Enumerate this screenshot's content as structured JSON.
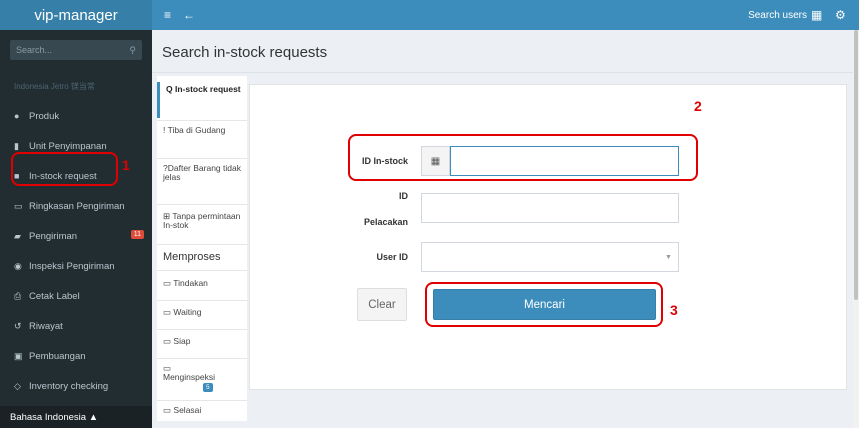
{
  "topbar": {
    "brand": "vip-manager",
    "menu_icon": "≡",
    "back_icon": "←",
    "search_users": "Search users",
    "grid_icon": "▦",
    "settings_icon": "⚙"
  },
  "sidebar": {
    "search_placeholder": "Search...",
    "search_icon": "🔍",
    "header": "Indonesia Jetro 镁当常",
    "items": [
      {
        "label": "Produk",
        "icon": "●"
      },
      {
        "label": "Unit Penyimpanan",
        "icon": "▮"
      },
      {
        "label": "In-stock request",
        "icon": "■"
      },
      {
        "label": "Ringkasan Pengiriman",
        "icon": "▭"
      },
      {
        "label": "Pengiriman",
        "icon": "▰",
        "badge": "11"
      },
      {
        "label": "Inspeksi Pengiriman",
        "icon": "◉"
      },
      {
        "label": "Cetak Label",
        "icon": "⎙"
      },
      {
        "label": "Riwayat",
        "icon": "↺"
      },
      {
        "label": "Pembuangan",
        "icon": "▣"
      },
      {
        "label": "Inventory checking",
        "icon": "◇"
      }
    ],
    "language": "Bahasa Indonesia ▲"
  },
  "page": {
    "title": "Search in-stock requests"
  },
  "subnav": {
    "items": [
      {
        "label": "Q In-stock request"
      },
      {
        "label": "! Tiba di Gudang"
      },
      {
        "label": "?Dafter Barang tidak jelas"
      },
      {
        "label": "Tanpa permintaan In-stok",
        "icon": "⊞"
      }
    ],
    "section": "Memproses",
    "process_items": [
      {
        "label": "Tindakan",
        "icon": "▭"
      },
      {
        "label": "Waiting",
        "icon": "▭"
      },
      {
        "label": "Siap",
        "icon": "▭"
      },
      {
        "label": "Menginspeksi",
        "icon": "▭",
        "badge": "5"
      },
      {
        "label": "Selasai",
        "icon": "▭"
      }
    ]
  },
  "form": {
    "id_instock_label": "ID In-stock",
    "id_instock_value": "",
    "barcode_icon": "▦",
    "tracking_label_1": "ID",
    "tracking_label_2": "Pelacakan",
    "tracking_value": "",
    "user_id_label": "User ID",
    "user_id_value": "",
    "caret": "▼",
    "clear_button": "Clear",
    "search_button": "Mencari"
  },
  "annotations": [
    "1",
    "2",
    "3"
  ],
  "colors": {
    "topbar": "#3c8dbc",
    "sidebar": "#222d32",
    "primary": "#3c8dbc",
    "annotation": "#e00000"
  }
}
